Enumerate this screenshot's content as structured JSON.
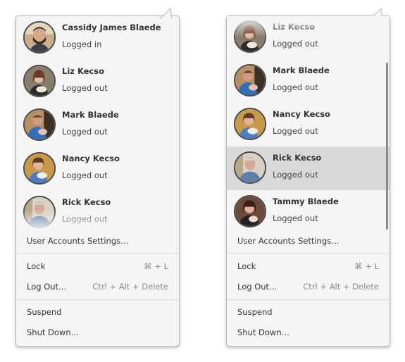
{
  "colors": {
    "menu_bg": "#f5f5f5",
    "highlight": "#d9d9d9",
    "shortcut_text": "#8a8a8a"
  },
  "left_menu": {
    "users": [
      {
        "name": "Cassidy James Blaede",
        "status": "Logged in",
        "avatar": "cassidy"
      },
      {
        "name": "Liz Kecso",
        "status": "Logged out",
        "avatar": "liz"
      },
      {
        "name": "Mark Blaede",
        "status": "Logged out",
        "avatar": "mark"
      },
      {
        "name": "Nancy Kecso",
        "status": "Logged out",
        "avatar": "nancy"
      },
      {
        "name": "Rick Kecso",
        "status": "Logged out",
        "avatar": "rick"
      }
    ],
    "settings_label": "User Accounts Settings…",
    "lock_label": "Lock",
    "lock_shortcut": "⌘ + L",
    "logout_label": "Log Out…",
    "logout_shortcut": "Ctrl + Alt + Delete",
    "suspend_label": "Suspend",
    "shutdown_label": "Shut Down…"
  },
  "right_menu": {
    "users": [
      {
        "name": "Liz Kecso",
        "status": "Logged out",
        "avatar": "liz"
      },
      {
        "name": "Mark Blaede",
        "status": "Logged out",
        "avatar": "mark"
      },
      {
        "name": "Nancy Kecso",
        "status": "Logged out",
        "avatar": "nancy"
      },
      {
        "name": "Rick Kecso",
        "status": "Logged out",
        "avatar": "rick",
        "highlighted": true
      },
      {
        "name": "Tammy Blaede",
        "status": "Logged out",
        "avatar": "tammy"
      }
    ],
    "settings_label": "User Accounts Settings…",
    "lock_label": "Lock",
    "lock_shortcut": "⌘ + L",
    "logout_label": "Log Out…",
    "logout_shortcut": "Ctrl + Alt + Delete",
    "suspend_label": "Suspend",
    "shutdown_label": "Shut Down…"
  }
}
